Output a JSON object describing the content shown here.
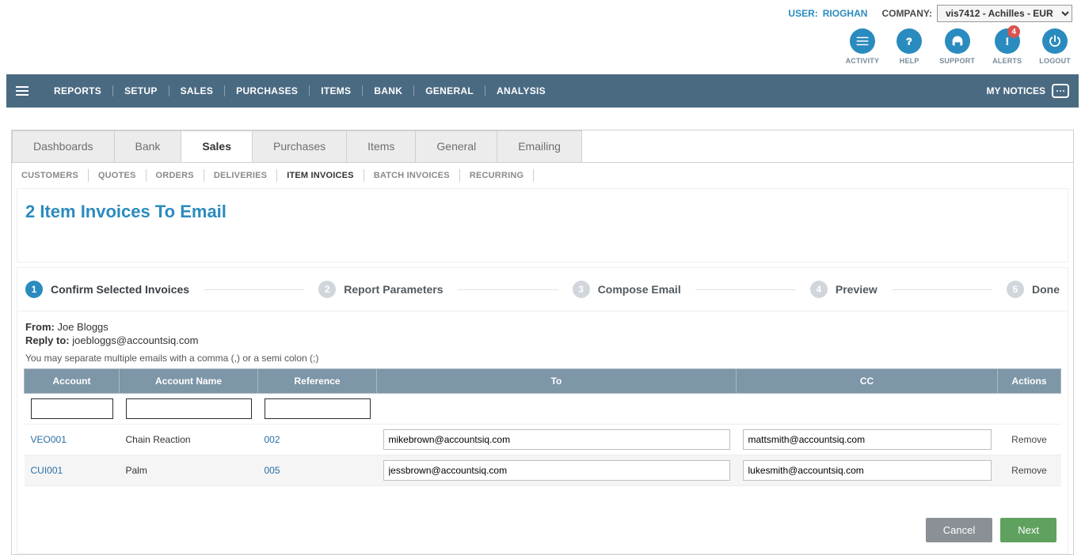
{
  "header": {
    "user_label": "USER:",
    "user_name": "RIOGHAN",
    "company_label": "COMPANY:",
    "company_value": "vis7412 - Achilles - EUR"
  },
  "toolbar_icons": {
    "activity": "ACTIVITY",
    "help": "HELP",
    "support": "SUPPORT",
    "alerts": "ALERTS",
    "alerts_badge": "4",
    "logout": "LOGOUT"
  },
  "main_nav": {
    "items": [
      "REPORTS",
      "SETUP",
      "SALES",
      "PURCHASES",
      "ITEMS",
      "BANK",
      "GENERAL",
      "ANALYSIS"
    ],
    "my_notices": "MY NOTICES"
  },
  "tabs": [
    "Dashboards",
    "Bank",
    "Sales",
    "Purchases",
    "Items",
    "General",
    "Emailing"
  ],
  "active_tab_index": 2,
  "sub_nav": [
    "CUSTOMERS",
    "QUOTES",
    "ORDERS",
    "DELIVERIES",
    "ITEM INVOICES",
    "BATCH INVOICES",
    "RECURRING"
  ],
  "active_sub_index": 4,
  "page_title": "2 Item Invoices To Email",
  "steps": [
    {
      "num": "1",
      "label": "Confirm Selected Invoices",
      "active": true
    },
    {
      "num": "2",
      "label": "Report Parameters",
      "active": false
    },
    {
      "num": "3",
      "label": "Compose Email",
      "active": false
    },
    {
      "num": "4",
      "label": "Preview",
      "active": false
    },
    {
      "num": "5",
      "label": "Done",
      "active": false
    }
  ],
  "from_label": "From:",
  "from_value": "Joe Bloggs",
  "reply_label": "Reply to:",
  "reply_value": "joebloggs@accountsiq.com",
  "note": "You may separate multiple emails with a comma (,) or a semi colon (;)",
  "columns": {
    "account": "Account",
    "account_name": "Account Name",
    "reference": "Reference",
    "to": "To",
    "cc": "CC",
    "actions": "Actions"
  },
  "rows": [
    {
      "account": "VEO001",
      "name": "Chain Reaction",
      "ref": "002",
      "to": "mikebrown@accountsiq.com",
      "cc": "mattsmith@accountsiq.com",
      "remove": "Remove"
    },
    {
      "account": "CUI001",
      "name": "Palm",
      "ref": "005",
      "to": "jessbrown@accountsiq.com",
      "cc": "lukesmith@accountsiq.com",
      "remove": "Remove"
    }
  ],
  "buttons": {
    "cancel": "Cancel",
    "next": "Next"
  }
}
